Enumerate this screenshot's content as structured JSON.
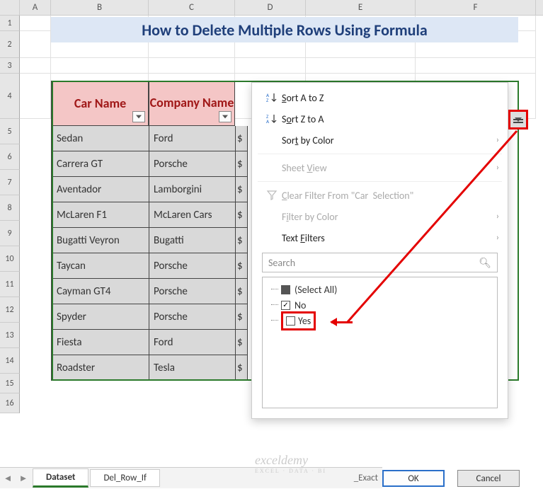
{
  "title": "How to Delete Multiple Rows Using Formula",
  "columns": [
    "A",
    "B",
    "C",
    "D",
    "E",
    "F"
  ],
  "row_numbers": [
    1,
    2,
    3,
    4,
    5,
    6,
    7,
    8,
    9,
    10,
    11,
    12,
    13,
    14,
    15,
    16
  ],
  "headers": {
    "col1": "Car Name",
    "col2": "Company Name"
  },
  "table_rows": [
    {
      "car": "Sedan",
      "company": "Ford",
      "extra": "$"
    },
    {
      "car": "Carrera GT",
      "company": "Porsche",
      "extra": "$"
    },
    {
      "car": "Aventador",
      "company": "Lamborgini",
      "extra": "$"
    },
    {
      "car": "McLaren F1",
      "company": "McLaren Cars",
      "extra": "$"
    },
    {
      "car": "Bugatti Veyron",
      "company": "Bugatti",
      "extra": "$"
    },
    {
      "car": "Taycan",
      "company": "Porsche",
      "extra": "$"
    },
    {
      "car": "Cayman GT4",
      "company": "Porsche",
      "extra": "$"
    },
    {
      "car": "Spyder",
      "company": "Porsche",
      "extra": "$"
    },
    {
      "car": "Fiesta",
      "company": "Ford",
      "extra": "$"
    },
    {
      "car": "Roadster",
      "company": "Tesla",
      "extra": "$"
    }
  ],
  "menu": {
    "sort_az": "Sort A to Z",
    "sort_za": "Sort Z to A",
    "sort_color": "Sort by Color",
    "sheet_view": "Sheet View",
    "clear_filter": "Clear Filter From \"Car  Selection\"",
    "filter_color": "Filter by Color",
    "text_filters": "Text Filters",
    "search_placeholder": "Search",
    "select_all": "(Select All)",
    "opt_no": "No",
    "opt_yes": "Yes",
    "ok": "OK",
    "cancel": "Cancel"
  },
  "sheet_tabs": {
    "active": "Dataset",
    "other": "Del_Row_If",
    "partial": "_Exact"
  },
  "watermark": {
    "main": "exceldemy",
    "sub": "EXCEL · DATA · BI"
  }
}
